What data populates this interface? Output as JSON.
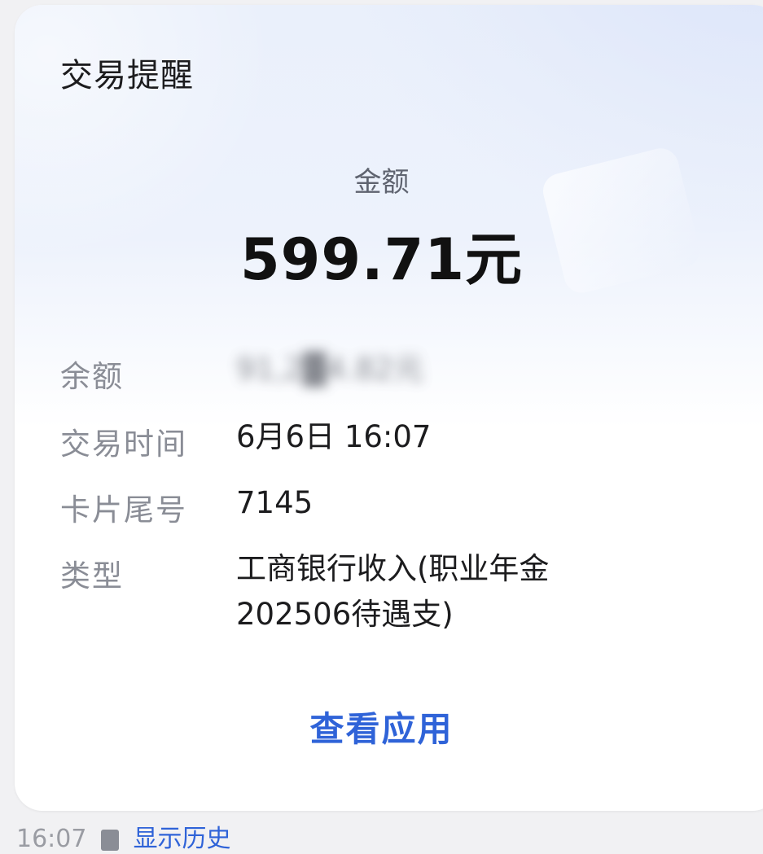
{
  "card": {
    "title": "交易提醒",
    "amount_label": "金额",
    "amount_value": "599.71元"
  },
  "details": [
    {
      "label": "余额",
      "value": "91,2█4.82元"
    },
    {
      "label": "交易时间",
      "value": "6月6日 16:07"
    },
    {
      "label": "卡片尾号",
      "value": "7145"
    },
    {
      "label": "类型",
      "value": "工商银行收入(职业年金202506待遇支)"
    }
  ],
  "action": {
    "view_app_label": "查看应用"
  },
  "footer": {
    "time": "16:07",
    "link_text": "显示历史"
  },
  "colors": {
    "accent": "#2f63d8",
    "title_text": "#1c1c1e",
    "label_text": "#8a8d96"
  }
}
